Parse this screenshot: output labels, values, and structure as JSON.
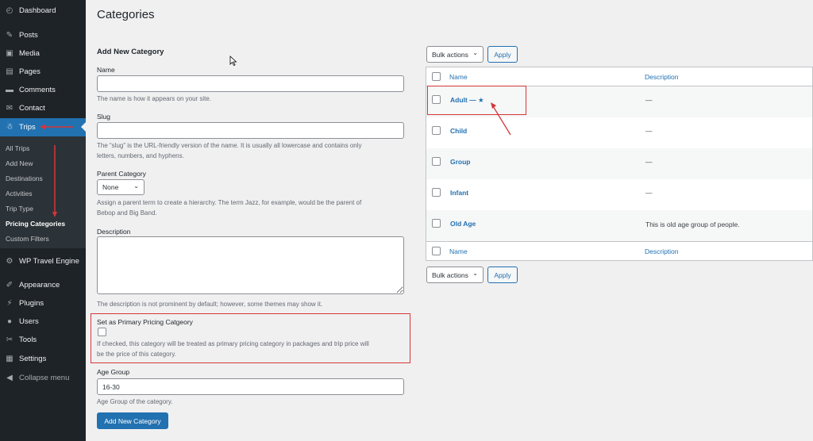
{
  "sidebar": {
    "items": [
      {
        "label": "Dashboard",
        "icon": "dashboard-icon"
      },
      {
        "label": "Posts",
        "icon": "pin-icon"
      },
      {
        "label": "Media",
        "icon": "media-icon"
      },
      {
        "label": "Pages",
        "icon": "pages-icon"
      },
      {
        "label": "Comments",
        "icon": "comment-icon"
      },
      {
        "label": "Contact",
        "icon": "envelope-icon"
      },
      {
        "label": "Trips",
        "icon": "hikers-icon"
      },
      {
        "label": "WP Travel Engine",
        "icon": "gear-icon"
      },
      {
        "label": "Appearance",
        "icon": "brush-icon"
      },
      {
        "label": "Plugins",
        "icon": "plug-icon"
      },
      {
        "label": "Users",
        "icon": "user-icon"
      },
      {
        "label": "Tools",
        "icon": "wrench-icon"
      },
      {
        "label": "Settings",
        "icon": "settings-icon"
      },
      {
        "label": "Collapse menu",
        "icon": "collapse-icon"
      }
    ],
    "submenu": [
      "All Trips",
      "Add New",
      "Destinations",
      "Activities",
      "Trip Type",
      "Pricing Categories",
      "Custom Filters"
    ]
  },
  "page": {
    "title": "Categories",
    "form": {
      "heading": "Add New Category",
      "name_label": "Name",
      "name_value": "",
      "name_desc": "The name is how it appears on your site.",
      "slug_label": "Slug",
      "slug_value": "",
      "slug_desc_1": "The “slug” is the URL-friendly version of the name. It is usually all lowercase and contains only",
      "slug_desc_2": "letters, numbers, and hyphens.",
      "parent_label": "Parent Category",
      "parent_value": "None",
      "parent_desc_1": "Assign a parent term to create a hierarchy. The term Jazz, for example, would be the parent of",
      "parent_desc_2": "Bebop and Big Band.",
      "description_label": "Description",
      "description_desc": "The description is not prominent by default; however, some themes may show it.",
      "primary_label": "Set as Primary Pricing Catgeory",
      "primary_desc_1": "If checked, this category will be treated as primary pricing category in packages and trip price will",
      "primary_desc_2": "be the price of this category.",
      "age_label": "Age Group",
      "age_value": "16-30",
      "age_desc": "Age Group of the category.",
      "submit_label": "Add New Category"
    },
    "list": {
      "bulk_label": "Bulk actions",
      "apply_label": "Apply",
      "col_name": "Name",
      "col_description": "Description",
      "rows": [
        {
          "name": "Adult — ★",
          "description": "—"
        },
        {
          "name": "Child",
          "description": "—"
        },
        {
          "name": "Group",
          "description": "—"
        },
        {
          "name": "Infant",
          "description": "—"
        },
        {
          "name": "Old Age",
          "description": "This is old age group of people."
        }
      ]
    }
  },
  "colors": {
    "sidebar_bg": "#1d2327",
    "accent": "#2271b1",
    "annotation_red": "#d63638"
  }
}
